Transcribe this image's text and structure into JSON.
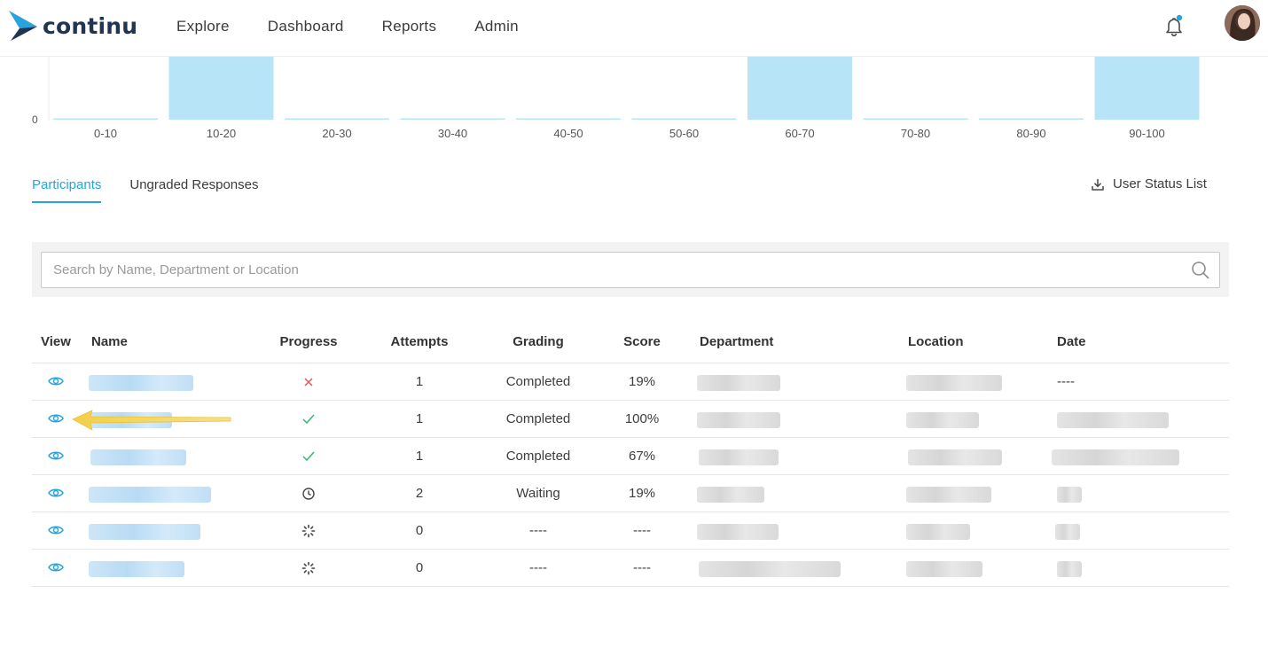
{
  "app": {
    "brand": "continu",
    "nav": [
      "Explore",
      "Dashboard",
      "Reports",
      "Admin"
    ],
    "accent": "#29a3dc"
  },
  "chart_data": {
    "type": "bar",
    "categories": [
      "0-10",
      "10-20",
      "20-30",
      "30-40",
      "40-50",
      "50-60",
      "60-70",
      "70-80",
      "80-90",
      "90-100"
    ],
    "values": [
      0,
      1,
      0,
      0,
      0,
      0,
      1,
      0,
      0,
      1
    ],
    "ylim": [
      0,
      1
    ],
    "y_tick_visible": "0",
    "bar_color": "#b7e4f7"
  },
  "tabs": {
    "participants": "Participants",
    "ungraded": "Ungraded Responses"
  },
  "export": {
    "label": "User Status List"
  },
  "search": {
    "placeholder": "Search by Name, Department or Location",
    "value": ""
  },
  "table": {
    "headers": {
      "view": "View",
      "name": "Name",
      "progress": "Progress",
      "attempts": "Attempts",
      "grading": "Grading",
      "score": "Score",
      "department": "Department",
      "location": "Location",
      "date": "Date"
    },
    "rows": [
      {
        "progress_icon": "x-icon",
        "attempts": "1",
        "grading": "Completed",
        "score": "19%",
        "date": "----"
      },
      {
        "progress_icon": "check-icon",
        "attempts": "1",
        "grading": "Completed",
        "score": "100%",
        "date": ""
      },
      {
        "progress_icon": "check-icon",
        "attempts": "1",
        "grading": "Completed",
        "score": "67%",
        "date": ""
      },
      {
        "progress_icon": "clock-icon",
        "attempts": "2",
        "grading": "Waiting",
        "score": "19%",
        "date": ""
      },
      {
        "progress_icon": "spinner-icon",
        "attempts": "0",
        "grading": "----",
        "score": "----",
        "date": ""
      },
      {
        "progress_icon": "spinner-icon",
        "attempts": "0",
        "grading": "----",
        "score": "----",
        "date": ""
      }
    ]
  }
}
